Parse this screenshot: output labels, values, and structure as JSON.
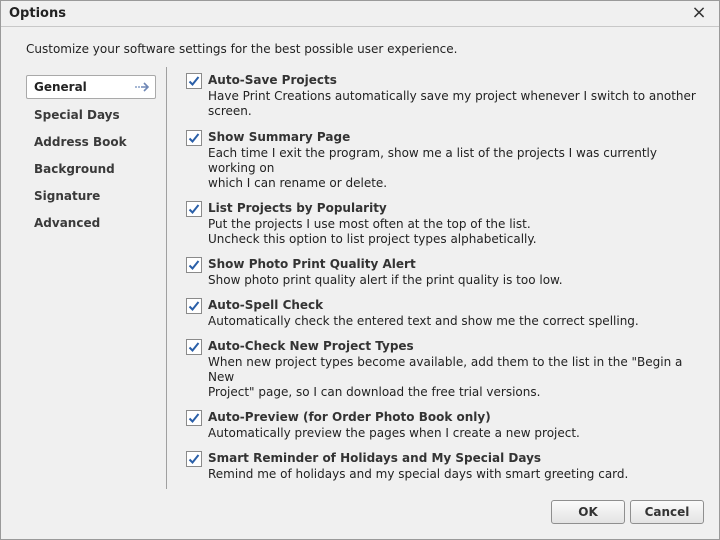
{
  "window": {
    "title": "Options",
    "close_symbol": "×"
  },
  "intro_text": "Customize your software settings for the best possible user experience.",
  "sidebar": {
    "items": [
      {
        "label": "General",
        "active": true
      },
      {
        "label": "Special Days"
      },
      {
        "label": "Address Book"
      },
      {
        "label": "Background"
      },
      {
        "label": "Signature"
      },
      {
        "label": "Advanced"
      }
    ]
  },
  "options": [
    {
      "title": "Auto-Save Projects",
      "checked": true,
      "desc": [
        "Have Print Creations automatically save my project whenever I switch to another screen."
      ]
    },
    {
      "title": "Show Summary Page",
      "checked": true,
      "desc": [
        "Each time I exit the program, show me a list of the projects I was currently working on",
        "which I can rename or delete."
      ]
    },
    {
      "title": "List Projects by Popularity",
      "checked": true,
      "desc": [
        "Put the projects I use most often at the top of the list.",
        "Uncheck this option to list project types alphabetically."
      ]
    },
    {
      "title": "Show Photo Print Quality Alert",
      "checked": true,
      "desc": [
        "Show photo print quality alert if the print quality is too low."
      ]
    },
    {
      "title": "Auto-Spell Check",
      "checked": true,
      "desc": [
        "Automatically check the entered text and show me the correct spelling."
      ]
    },
    {
      "title": "Auto-Check New Project Types",
      "checked": true,
      "desc": [
        "When new project types become available, add them to the list in the \"Begin a New",
        "Project\" page, so I can download the free trial versions."
      ]
    },
    {
      "title": "Auto-Preview (for Order Photo Book only)",
      "checked": true,
      "desc": [
        "Automatically preview the pages when I create a new project."
      ]
    },
    {
      "title": "Smart Reminder of Holidays and My Special Days",
      "checked": true,
      "desc": [
        "Remind me of holidays and my special days with smart greeting card."
      ]
    }
  ],
  "buttons": {
    "ok_label": "OK",
    "cancel_label": "Cancel"
  },
  "icons": {
    "checkbox_check": "check-icon",
    "active_arrow": "arrow-right-icon",
    "close": "close-icon"
  },
  "colors": {
    "check": "#2a5fa8",
    "window_bg": "#f0f0f0"
  }
}
